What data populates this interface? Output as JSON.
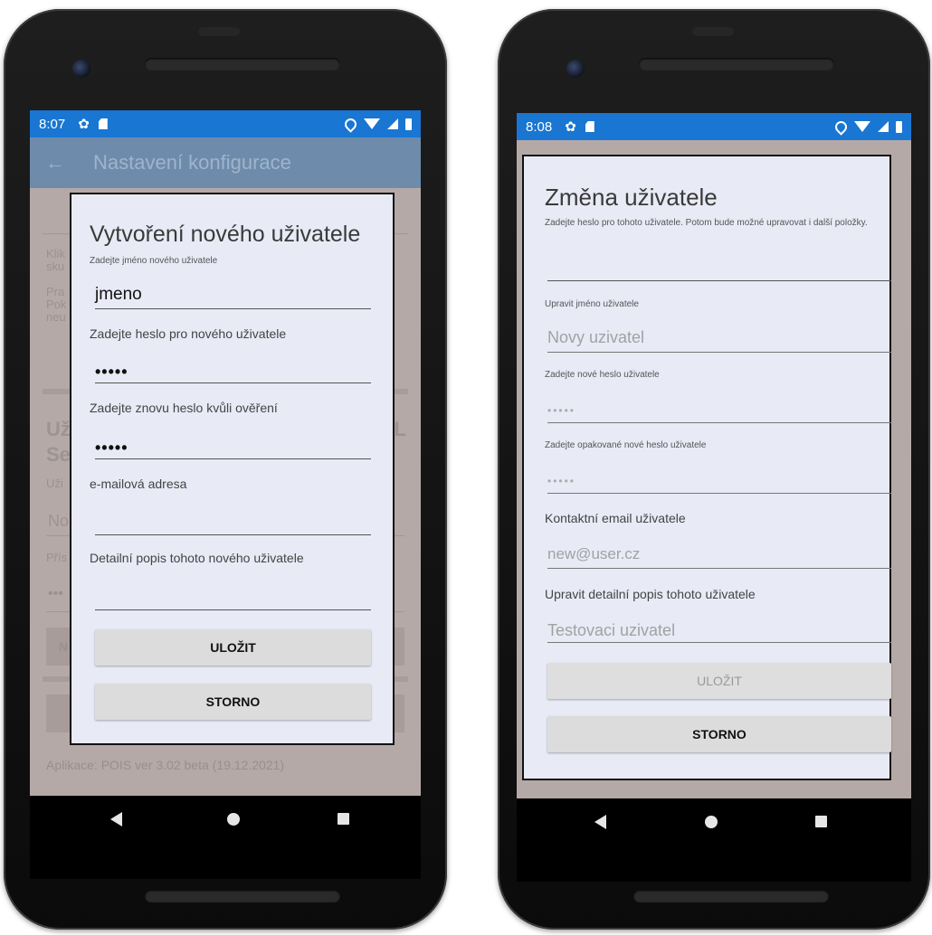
{
  "left_phone": {
    "status": {
      "time": "8:07"
    },
    "appbar": {
      "title": "Nastavení konfigurace"
    },
    "background": {
      "text1": "Klik",
      "text2": "sku",
      "text3": "Pra",
      "text4": "Pok",
      "text5": "neu",
      "big1": "Už",
      "big2": "Se",
      "big_right": "QL",
      "small1": "Uži",
      "field1": "No",
      "small2": "Přís",
      "dots": "•••",
      "btn_partial": "N",
      "footer": "Aplikace: POIS ver 3.02 beta (19.12.2021)"
    },
    "dialog": {
      "title": "Vytvoření nového uživatele",
      "name_label": "Zadejte jméno nového uživatele",
      "name_value": "jmeno",
      "password_label": "Zadejte heslo pro nového uživatele",
      "password_value": "•••••",
      "password_confirm_label": "Zadejte znovu heslo kvůli ověření",
      "password_confirm_value": "•••••",
      "email_label": "e-mailová adresa",
      "email_value": "",
      "description_label": "Detailní popis tohoto nového uživatele",
      "description_value": "",
      "save_button": "ULOŽIT",
      "cancel_button": "STORNO"
    }
  },
  "right_phone": {
    "status": {
      "time": "8:08"
    },
    "dialog": {
      "title": "Změna uživatele",
      "instructions": "Zadejte heslo pro tohoto uživatele. Potom bude možné upravovat i další položky.",
      "password_value": "",
      "name_label": "Upravit jméno uživatele",
      "name_placeholder": "Novy uzivatel",
      "new_password_label": "Zadejte nové heslo uživatele",
      "new_password_placeholder": "•••••",
      "repeat_password_label": "Zadejte opakované nové heslo uživatele",
      "repeat_password_placeholder": "•••••",
      "email_label": "Kontaktní email uživatele",
      "email_placeholder": "new@user.cz",
      "description_label": "Upravit detailní popis tohoto uživatele",
      "description_placeholder": "Testovaci uzivatel",
      "save_button": "ULOŽIT",
      "cancel_button": "STORNO"
    }
  },
  "colors": {
    "status_bar": "#1976d2",
    "dialog_bg": "#e8eaf6",
    "scrim": "#b5a9a8"
  }
}
